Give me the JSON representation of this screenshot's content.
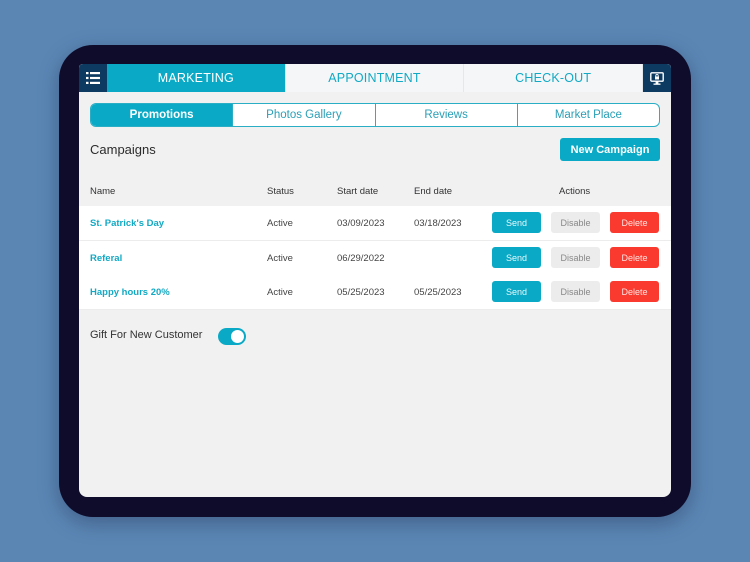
{
  "colors": {
    "accent": "#0aaac6",
    "nav_dark": "#0c3a61",
    "delete": "#fb3a2f",
    "disable": "#ececec",
    "background": "#5b86b4",
    "device_bezel": "#0e0c2a"
  },
  "topnav": {
    "menu_icon": "list-icon",
    "lock_icon": "monitor-lock-icon",
    "tabs": [
      {
        "label": "MARKETING",
        "active": true
      },
      {
        "label": "APPOINTMENT",
        "active": false
      },
      {
        "label": "CHECK-OUT",
        "active": false
      }
    ]
  },
  "segments": [
    {
      "label": "Promotions",
      "active": true
    },
    {
      "label": "Photos Gallery",
      "active": false
    },
    {
      "label": "Reviews",
      "active": false
    },
    {
      "label": "Market Place",
      "active": false
    }
  ],
  "campaigns": {
    "title": "Campaigns",
    "new_button": "New Campaign",
    "columns": {
      "name": "Name",
      "status": "Status",
      "start": "Start date",
      "end": "End date",
      "actions": "Actions"
    },
    "rows": [
      {
        "name": "St. Patrick's Day",
        "status": "Active",
        "start": "03/09/2023",
        "end": "03/18/2023",
        "send": "Send",
        "disable": "Disable",
        "delete": "Delete"
      },
      {
        "name": "Referal",
        "status": "Active",
        "start": "06/29/2022",
        "end": "",
        "send": "Send",
        "disable": "Disable",
        "delete": "Delete"
      },
      {
        "name": "Happy hours 20%",
        "status": "Active",
        "start": "05/25/2023",
        "end": "05/25/2023",
        "send": "Send",
        "disable": "Disable",
        "delete": "Delete"
      }
    ]
  },
  "gift": {
    "label": "Gift For New Customer",
    "enabled": true
  }
}
